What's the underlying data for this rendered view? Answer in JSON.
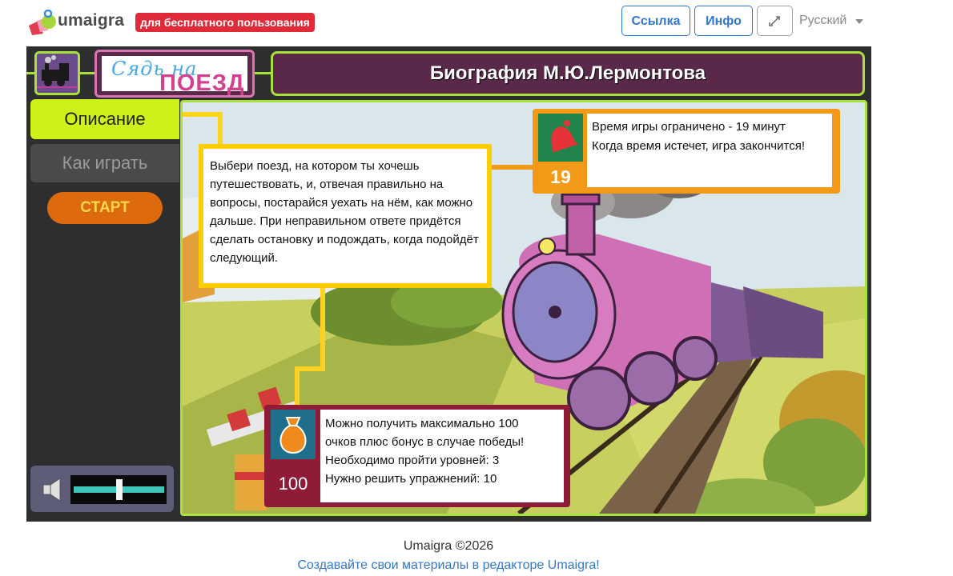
{
  "topbar": {
    "brand": "umaigra",
    "free_badge": "для бесплатного пользования",
    "link_button": "Ссылка",
    "info_button": "Инфо",
    "fullscreen_icon": "expand-arrows-icon",
    "language": "Русский"
  },
  "game": {
    "title": "Биография М.Ю.Лермонтова",
    "sign_top": "Сядь на",
    "sign_bottom": "ПОЕЗД",
    "tabs": [
      {
        "label": "Описание",
        "active": true
      },
      {
        "label": "Как играть",
        "active": false
      }
    ],
    "start_button": "СТАРТ",
    "volume_level": 0.5,
    "description": "Выбери поезд, на котором ты хочешь путешествовать, и, отвечая правильно на вопросы, постарайся уехать на нём, как можно дальше. При неправильном ответе придётся сделать остановку и подождать, когда подойдёт следующий.",
    "time": {
      "value": "19",
      "line1": "Время игры ограничено - 19 минут",
      "line2": "Когда время истечет, игра закончится!",
      "icon": "bell-icon"
    },
    "score": {
      "value": "100",
      "line1": "Можно получить максимально 100",
      "line2": "очков плюс бонус в случае победы!",
      "line3": "Необходимо пройти уровней: 3",
      "line4": "Нужно решить упражнений: 10",
      "icon": "money-bag-icon"
    },
    "colors": {
      "frame_green": "#a8e03c",
      "header_purple": "#5a2848",
      "start_orange": "#dd6a0c",
      "time_orange": "#f29a17",
      "score_red": "#8f1b36"
    }
  },
  "footer": {
    "copyright": "Umaigra ©2026",
    "editor_link": "Создавайте свои материалы в редакторе Umaigra!"
  }
}
